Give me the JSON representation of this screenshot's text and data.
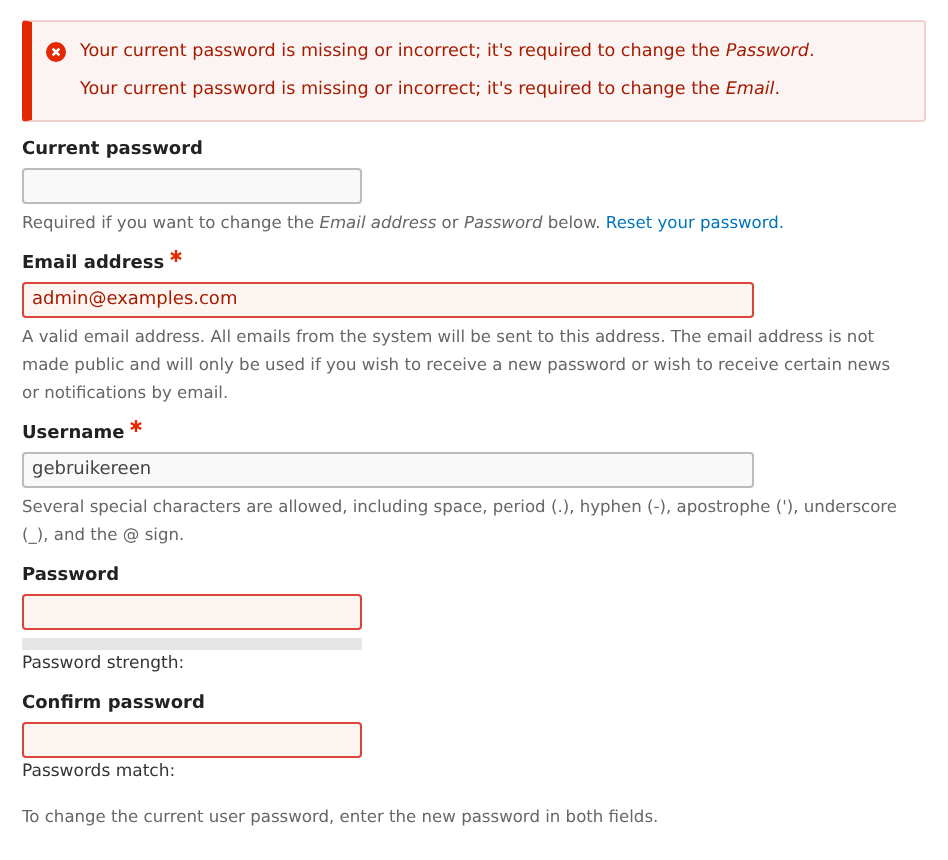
{
  "alert": {
    "messages": [
      "Your current password is missing or incorrect; it's required to change the *Password*.",
      "Your current password is missing or incorrect; it's required to change the *Email*."
    ]
  },
  "fields": [
    {
      "label": "Current password",
      "required": false,
      "error": false,
      "wide": false,
      "description": "Required if you want to change the *Email address* or *Password* below.",
      "link": "Reset your password."
    },
    {
      "label": "Email address",
      "required": true,
      "error": true,
      "wide": true,
      "value": "admin@examples.com",
      "description": "A valid email address. All emails from the system will be sent to this address. The email address is not made public and will only be used if you wish to receive a new password or wish to receive certain news or notifications by email."
    },
    {
      "label": "Username",
      "required": true,
      "error": false,
      "wide": true,
      "value": "gebruikereen",
      "description": "Several special characters are allowed, including space, period (.), hyphen (-), apostrophe ('), underscore (_), and the @ sign."
    },
    {
      "label": "Password",
      "required": false,
      "error": true,
      "wide": false,
      "meter": {
        "level": 0
      },
      "status": "Password strength:"
    },
    {
      "label": "Confirm password",
      "required": false,
      "error": true,
      "wide": false,
      "status": "Passwords match:"
    }
  ],
  "footer": "To change the current user password, enter the new password in both fields."
}
